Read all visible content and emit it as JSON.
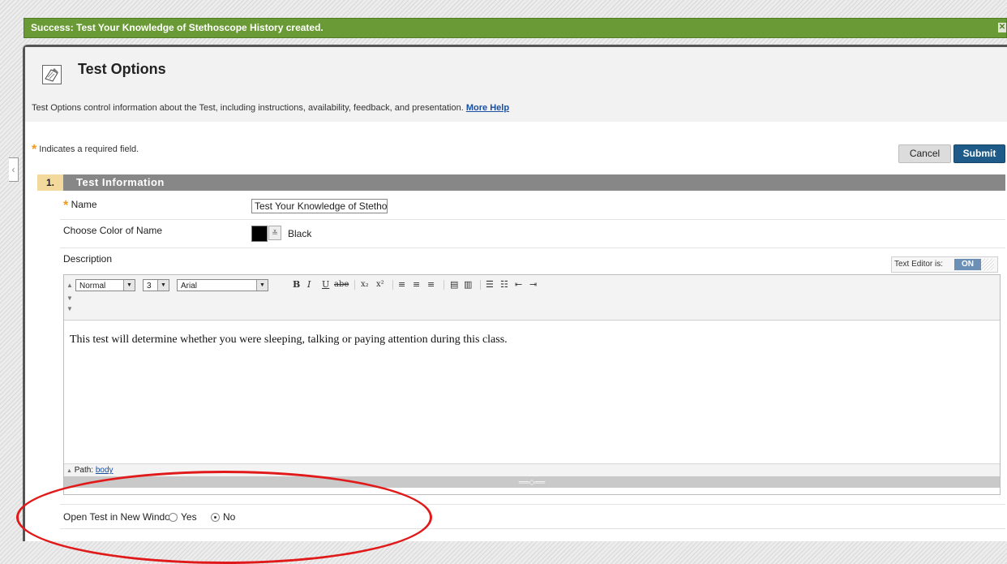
{
  "success": {
    "message": "Success: Test Your Knowledge of Stethoscope History created.",
    "close": "✕"
  },
  "header": {
    "title": "Test Options",
    "description": "Test Options control information about the Test, including instructions, availability, feedback, and presentation.",
    "more_help": "More Help"
  },
  "form": {
    "required_note": "Indicates a required field.",
    "cancel": "Cancel",
    "submit": "Submit"
  },
  "section": {
    "number": "1.",
    "title": "Test Information",
    "name_label": "Name",
    "name_value": "Test Your Knowledge of Stethoscope History",
    "color_label": "Choose Color of Name",
    "color_value": "Black",
    "color_swatch": "#000000",
    "description_label": "Description"
  },
  "editor": {
    "toggle_label": "Text Editor is:",
    "toggle_state": "ON",
    "style_select": "Normal",
    "size_select": "3",
    "font_select": "Arial",
    "buttons": [
      "B",
      "I",
      "U",
      "abe",
      "x₂",
      "x²",
      "≡",
      "≡",
      "≡",
      "▤",
      "▥",
      "☰",
      "☷",
      "⇤",
      "⇥"
    ],
    "body_text": "This test will determine whether you were sleeping, talking or paying attention during this class.",
    "path_label": "Path:",
    "path_link": "body",
    "resize_glyph": "══◇══"
  },
  "open_window": {
    "label": "Open Test in New Window",
    "yes": "Yes",
    "no": "No",
    "selected": "No"
  },
  "colors": {
    "success_green": "#6a9a35",
    "submit_blue": "#1f5b88",
    "section_gray": "#878787",
    "section_num_bg": "#f3d99b",
    "annotation_red": "#e01a1a"
  }
}
